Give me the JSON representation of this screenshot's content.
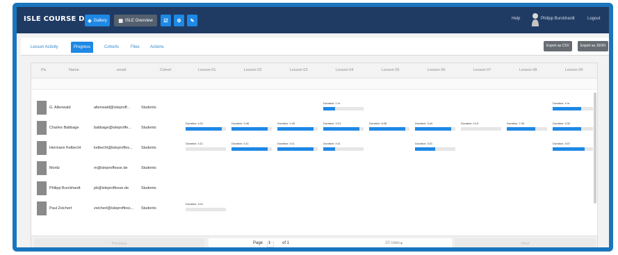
{
  "app": {
    "title": "ISLE COURSE DATA",
    "buttons": {
      "gallery": "Gallery",
      "lesson": "ISLE Overview",
      "icon1": "☑",
      "icon2": "⚙",
      "icon3": "✎"
    },
    "help": "Help",
    "user": "Philipp Burckhardt",
    "logout": "Logout"
  },
  "tabs": [
    {
      "label": "Lesson Activity",
      "active": false
    },
    {
      "label": "Progress",
      "active": true
    },
    {
      "label": "Cohorts",
      "active": false
    },
    {
      "label": "Files",
      "active": false
    },
    {
      "label": "Actions",
      "active": false
    }
  ],
  "export_buttons": [
    "Export as CSV",
    "Export as JSON"
  ],
  "columns": [
    "Pic",
    "Name",
    "email",
    "Cohort",
    "Lesson 01",
    "Lesson 02",
    "Lesson 03",
    "Lesson 04",
    "Lesson 05",
    "Lesson 06",
    "Lesson 07",
    "Lesson 08",
    "Lesson 09"
  ],
  "rows": [
    {
      "name": "G. Allenwald",
      "email": "allenwald@isleproff...",
      "cohort": "Students",
      "sessions": [
        {
          "col": 3,
          "label": "Duration: 1 hr",
          "progress": 0.3
        },
        {
          "col": 8,
          "label": "Duration: 4 hr",
          "progress": 0.7
        }
      ]
    },
    {
      "name": "Charles Babbage",
      "email": "babbage@isleproffe...",
      "cohort": "Students",
      "sessions": [
        {
          "col": 0,
          "label": "Duration: 4:31",
          "progress": 0.9
        },
        {
          "col": 1,
          "label": "Duration: 3:48",
          "progress": 0.9
        },
        {
          "col": 2,
          "label": "Duration: 1:40",
          "progress": 0.9
        },
        {
          "col": 3,
          "label": "Duration: 3:13",
          "progress": 0.9
        },
        {
          "col": 4,
          "label": "Duration: 8:48",
          "progress": 0.9
        },
        {
          "col": 5,
          "label": "Duration: 3:44",
          "progress": 0.9
        },
        {
          "col": 6,
          "label": "Duration: 4:13",
          "progress": 0.0
        },
        {
          "col": 7,
          "label": "Duration: 7:40",
          "progress": 0.7
        },
        {
          "col": 8,
          "label": "Duration: 3:32",
          "progress": 0.7
        }
      ]
    },
    {
      "name": "Hermann Kelbecht",
      "email": "kelbecht@isleproffes...",
      "cohort": "Students",
      "sessions": [
        {
          "col": 0,
          "label": "Duration: 4:11",
          "progress": 0.0
        },
        {
          "col": 1,
          "label": "Duration: 4:11",
          "progress": 0.9
        },
        {
          "col": 2,
          "label": "Duration: 4:11",
          "progress": 0.9
        },
        {
          "col": 3,
          "label": "Duration: 4:11",
          "progress": 0.3
        },
        {
          "col": 5,
          "label": "Duration: 3:31",
          "progress": 0.5
        },
        {
          "col": 8,
          "label": "Duration: 3:07",
          "progress": 0.8
        }
      ]
    },
    {
      "name": "Moritz",
      "email": "m@isleproffesse.de",
      "cohort": "Students",
      "sessions": []
    },
    {
      "name": "Philipp Burckhardt",
      "email": "pb@isleproffesse.de",
      "cohort": "Students",
      "sessions": []
    },
    {
      "name": "Paul Zeichert",
      "email": "zeichert@isleproffess...",
      "cohort": "Students",
      "sessions": [
        {
          "col": 0,
          "label": "Duration: 3:21",
          "progress": 0.0
        }
      ]
    }
  ],
  "pager": {
    "prev": "Previous",
    "page_label": "Page",
    "page": "1",
    "of": "of 1",
    "rows": "10 rows",
    "next": "Next"
  },
  "colors": {
    "frame": "#1a75bd",
    "nav": "#1f3b63",
    "accent": "#1e88e5"
  }
}
